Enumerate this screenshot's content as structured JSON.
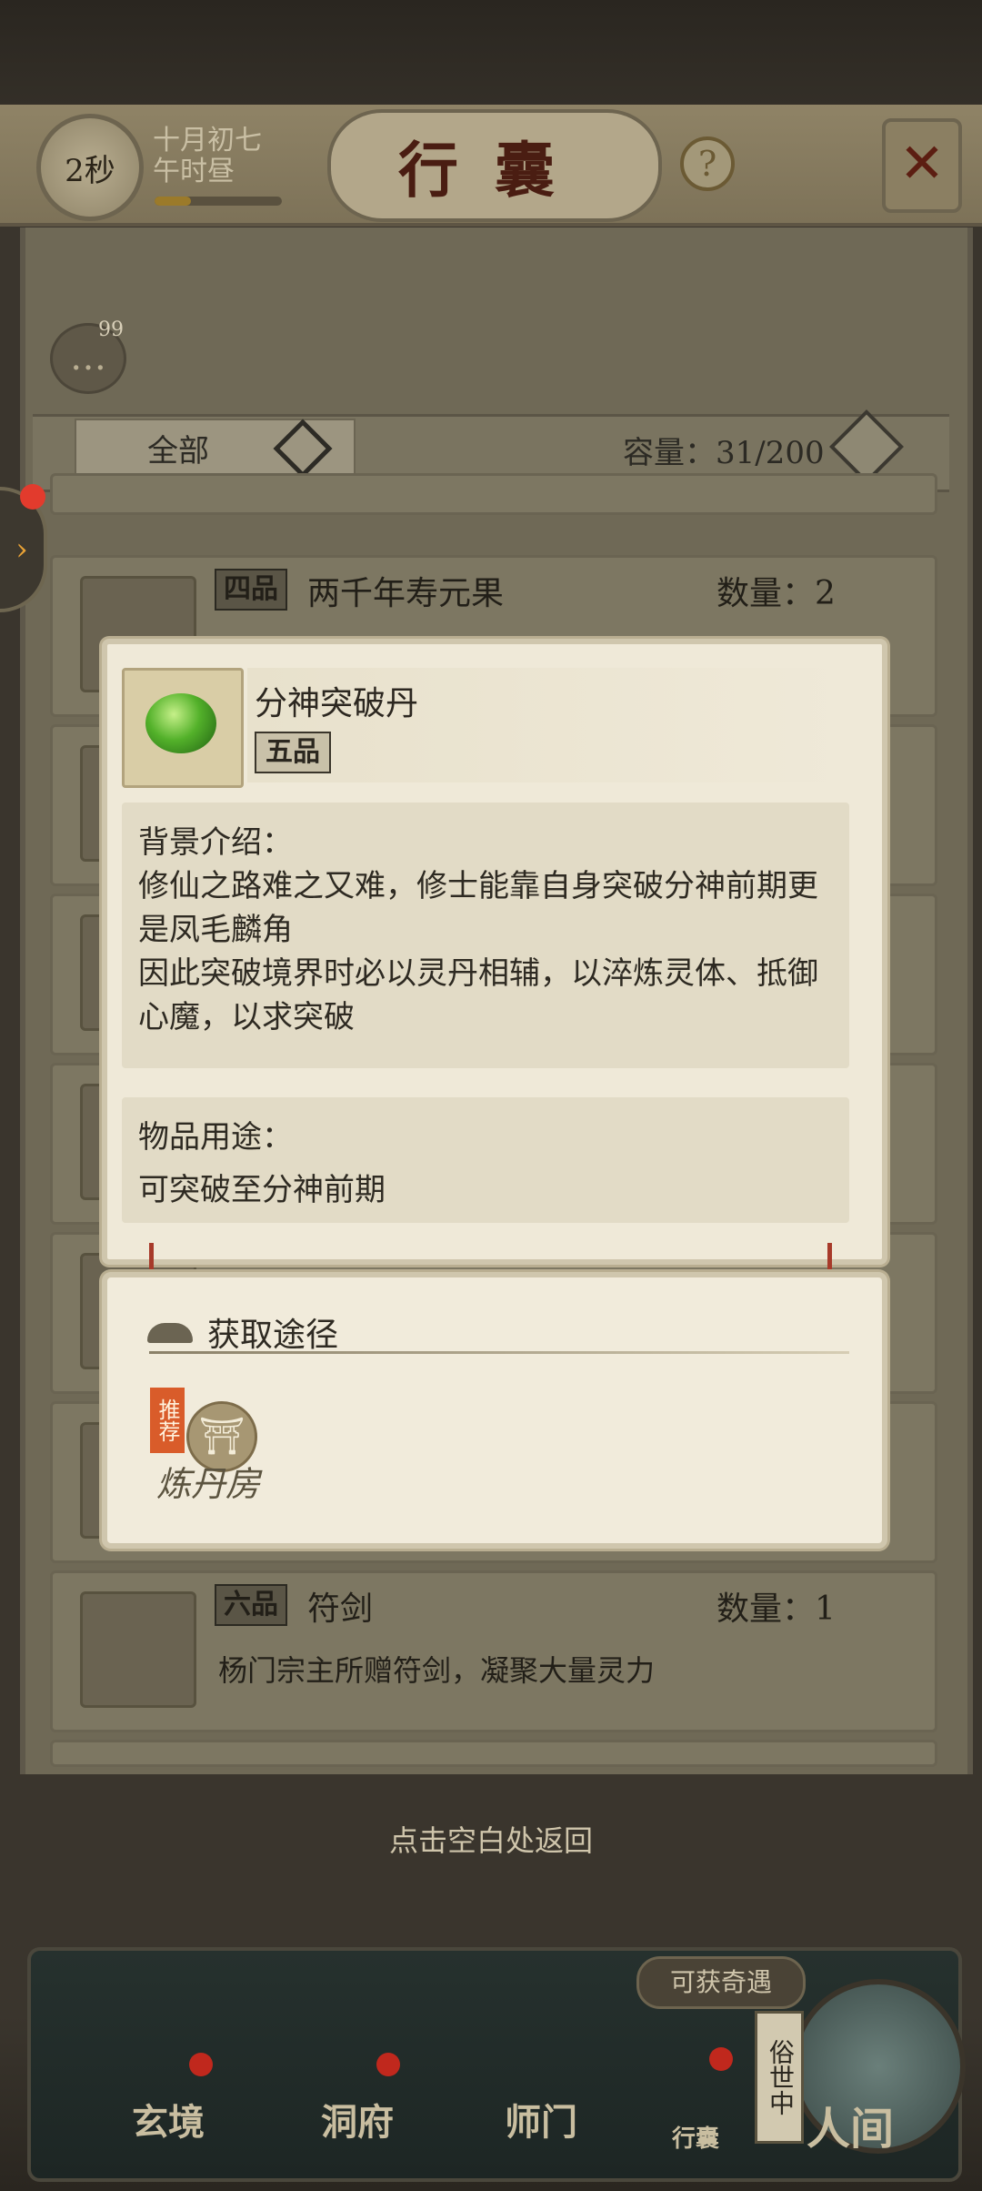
{
  "status": {
    "timer": "2秒",
    "date_line1": "十月初七",
    "date_line2": "午时昼"
  },
  "header": {
    "title": "行囊",
    "help": "?",
    "close": "✕"
  },
  "chat": {
    "count": "99"
  },
  "filter": {
    "selected": "全部",
    "capacity": "容量：31/200"
  },
  "items": [
    {
      "grade": "四品",
      "name": "两千年寿元果",
      "qty": "数量：2",
      "desc": ""
    },
    {
      "grade": "六品",
      "name": "符剑",
      "qty": "数量：1",
      "desc": "杨门宗主所赠符剑，凝聚大量灵力"
    }
  ],
  "detail": {
    "name": "分神突破丹",
    "grade": "五品",
    "bg_title": "背景介绍：",
    "bg_text": "修仙之路难之又难，修士能靠自身突破分神前期更是凤毛麟角\n因此突破境界时必以灵丹相辅，以淬炼灵体、抵御心魔，以求突破",
    "use_title": "物品用途：",
    "use_text": "可突破至分神前期"
  },
  "source": {
    "title": "获取途径",
    "recommend": "推荐",
    "place": "炼丹房"
  },
  "hint": "点击空白处返回",
  "nav": {
    "xuanjing": "玄境",
    "dongfu": "洞府",
    "shimen": "师门",
    "xingnang": "行囊",
    "renjian": "人间",
    "event": "可获奇遇",
    "secular": "俗世中"
  },
  "colors": {
    "accent_red": "#c0281d",
    "title_red": "#4a1d12",
    "jade_green": "#53b12a"
  }
}
